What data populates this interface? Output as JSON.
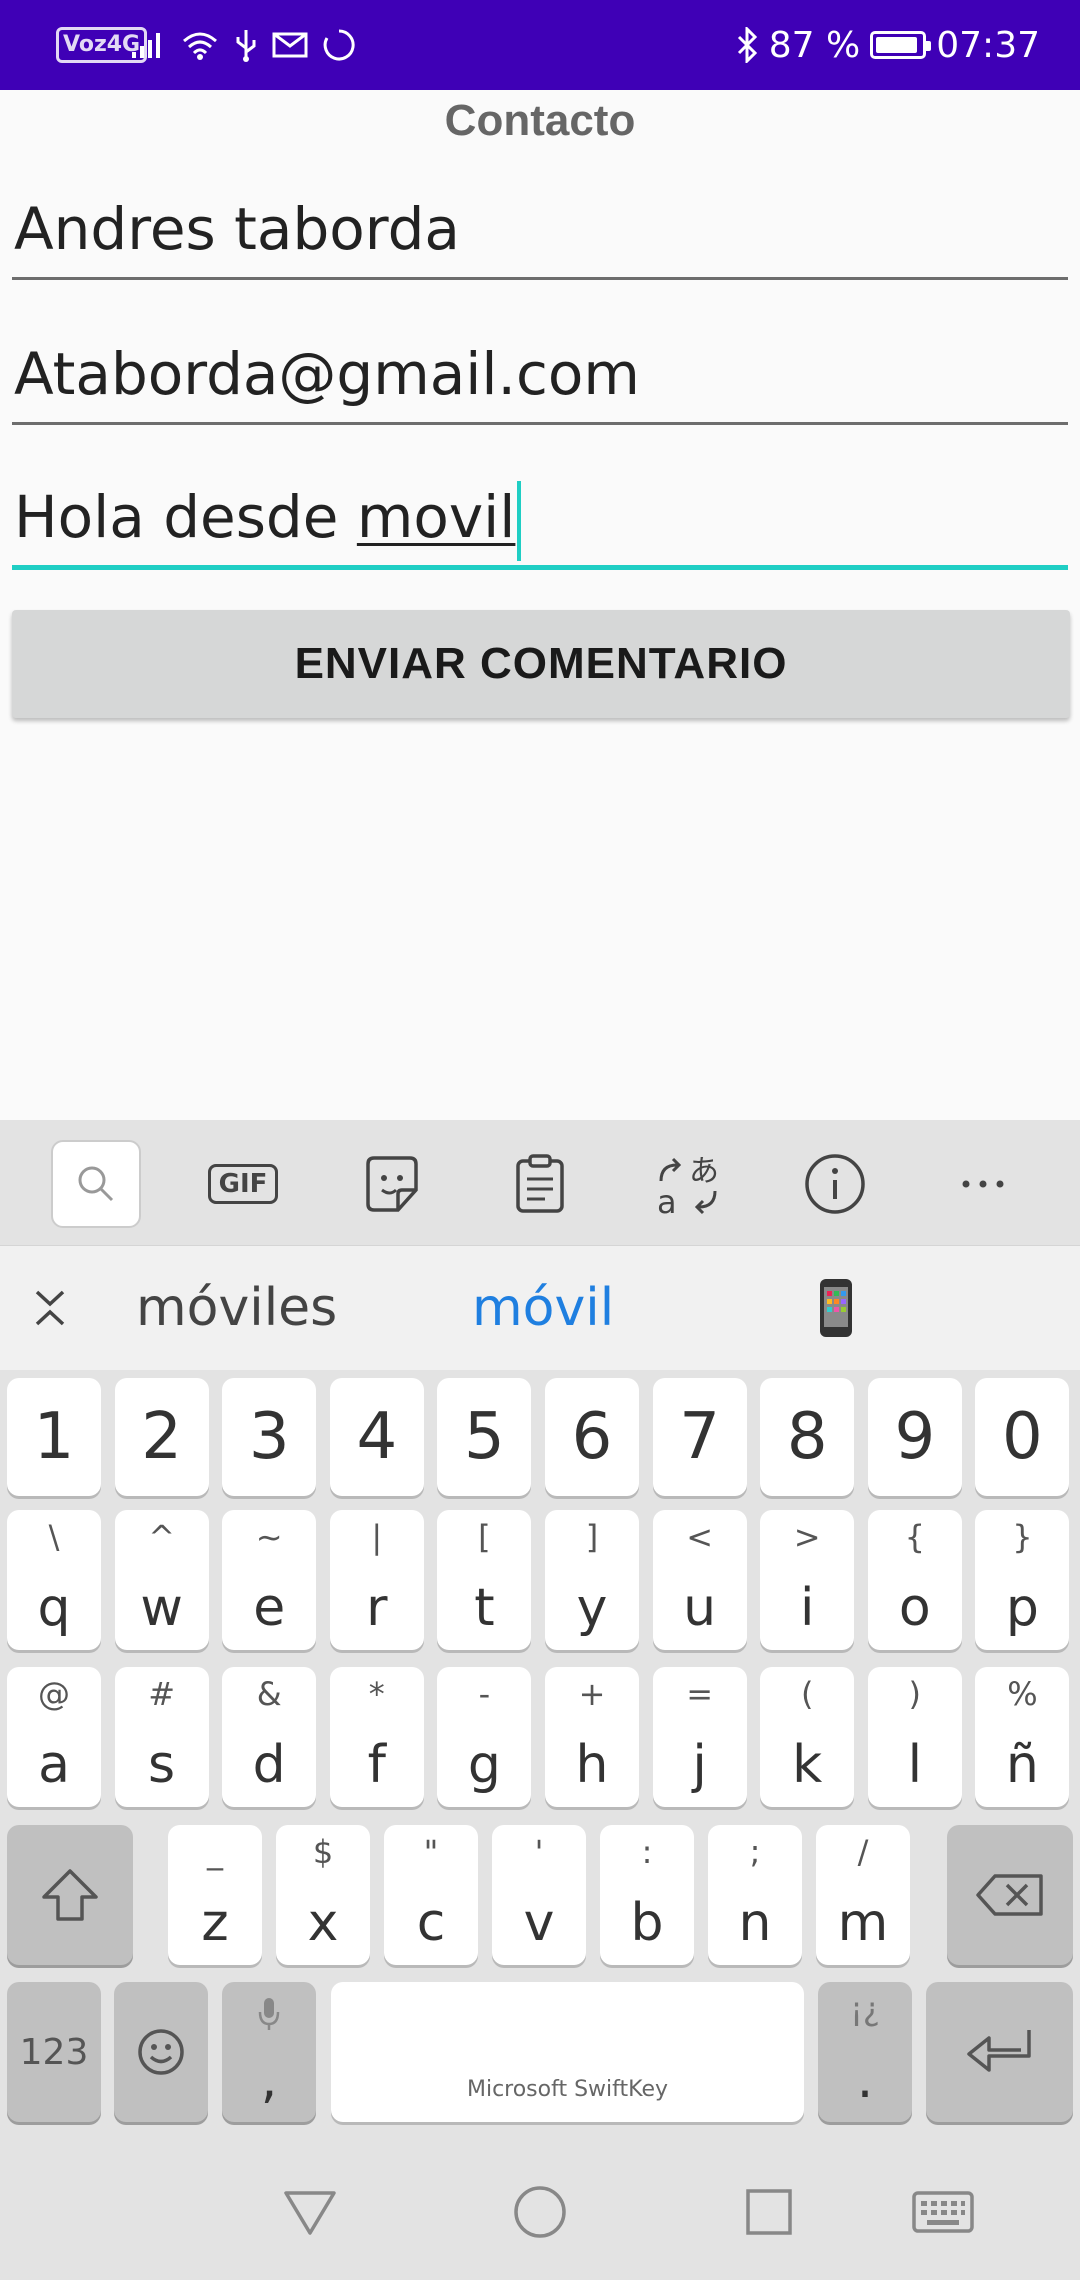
{
  "status_bar": {
    "volte": "Voz4G",
    "battery_text": "87 %",
    "battery_level": 0.87,
    "time": "07:37",
    "background": "#3f00b6"
  },
  "form": {
    "title": "Contacto",
    "name_value": "Andres taborda",
    "email_value": "Ataborda@gmail.com",
    "message_prefix": "Hola desde ",
    "message_composing": "movil",
    "send_label": "ENVIAR COMENTARIO",
    "focus_color": "#1fcec4"
  },
  "keyboard": {
    "toolbar_icons": [
      "search-icon",
      "gif-icon",
      "sticker-icon",
      "clipboard-icon",
      "translate-icon",
      "info-icon",
      "more-icon"
    ],
    "gif_label": "GIF",
    "suggestions": [
      "móviles",
      "móvil"
    ],
    "suggestion_emoji": "📱",
    "number_row": [
      "1",
      "2",
      "3",
      "4",
      "5",
      "6",
      "7",
      "8",
      "9",
      "0"
    ],
    "row1": [
      {
        "main": "q",
        "sec": "\\"
      },
      {
        "main": "w",
        "sec": "^"
      },
      {
        "main": "e",
        "sec": "~"
      },
      {
        "main": "r",
        "sec": "|"
      },
      {
        "main": "t",
        "sec": "["
      },
      {
        "main": "y",
        "sec": "]"
      },
      {
        "main": "u",
        "sec": "<"
      },
      {
        "main": "i",
        "sec": ">"
      },
      {
        "main": "o",
        "sec": "{"
      },
      {
        "main": "p",
        "sec": "}"
      }
    ],
    "row2": [
      {
        "main": "a",
        "sec": "@"
      },
      {
        "main": "s",
        "sec": "#"
      },
      {
        "main": "d",
        "sec": "&"
      },
      {
        "main": "f",
        "sec": "*"
      },
      {
        "main": "g",
        "sec": "-"
      },
      {
        "main": "h",
        "sec": "+"
      },
      {
        "main": "j",
        "sec": "="
      },
      {
        "main": "k",
        "sec": "("
      },
      {
        "main": "l",
        "sec": ")"
      },
      {
        "main": "ñ",
        "sec": "%"
      }
    ],
    "row3": [
      {
        "main": "z",
        "sec": "_"
      },
      {
        "main": "x",
        "sec": "$"
      },
      {
        "main": "c",
        "sec": "\""
      },
      {
        "main": "v",
        "sec": "'"
      },
      {
        "main": "b",
        "sec": ":"
      },
      {
        "main": "n",
        "sec": ";"
      },
      {
        "main": "m",
        "sec": "/"
      }
    ],
    "numbers_label": "123",
    "comma_label": ",",
    "period_label": ".",
    "period_sec": "¡¿",
    "space_label": "Microsoft SwiftKey"
  }
}
